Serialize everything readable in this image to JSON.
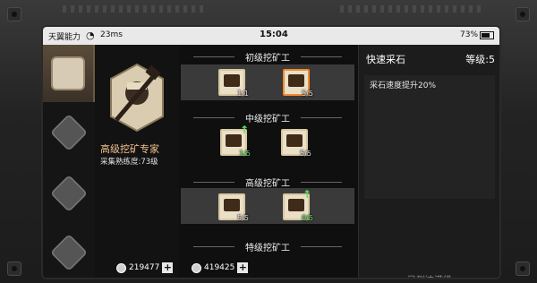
{
  "status_bar": {
    "carrier": "天翼能力",
    "ping": "23ms",
    "time": "15:04",
    "battery_pct": "73%"
  },
  "side_tabs": [
    {
      "icon": "certificate-icon",
      "active": true
    },
    {
      "icon": "tool-badge-icon",
      "active": false
    },
    {
      "icon": "wrench-badge-icon",
      "active": false
    },
    {
      "icon": "hammer-badge-icon",
      "active": false
    }
  ],
  "worker": {
    "title": "高级挖矿专家",
    "proficiency": "采集熟练度:73级"
  },
  "tiers": [
    {
      "title": "初级挖矿工",
      "nodes": [
        {
          "count": "1/1",
          "highlight": false,
          "upgradable": false
        },
        {
          "count": "5/5",
          "highlight": true,
          "upgradable": false
        }
      ]
    },
    {
      "title": "中级挖矿工",
      "nodes": [
        {
          "count": "1/5",
          "highlight": false,
          "upgradable": true
        },
        {
          "count": "5/5",
          "highlight": false,
          "upgradable": false
        }
      ]
    },
    {
      "title": "高级挖矿工",
      "nodes": [
        {
          "count": "5/5",
          "highlight": false,
          "upgradable": false
        },
        {
          "count": "0/5",
          "highlight": false,
          "upgradable": true
        }
      ]
    },
    {
      "title": "特级挖矿工",
      "nodes": []
    }
  ],
  "currency": {
    "coin_a": "219477",
    "coin_b": "419425"
  },
  "info_panel": {
    "skill_name": "快速采石",
    "level": "等级:5",
    "description": "采石速度提升20%",
    "status": "已到达满级"
  },
  "colors": {
    "accent_orange": "#f08a30",
    "upgrade_green": "#5ee05e",
    "worker_title": "#f0c090"
  }
}
